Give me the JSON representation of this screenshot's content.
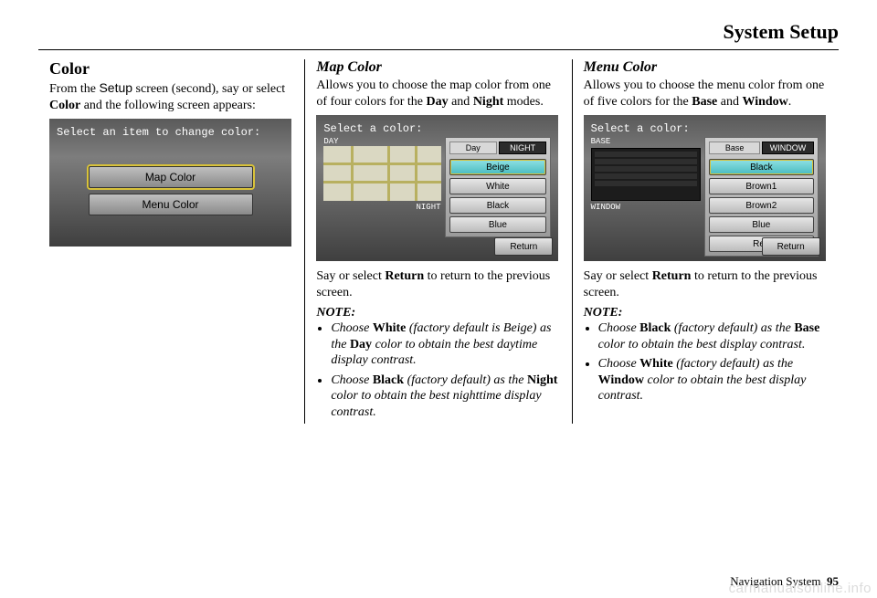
{
  "page": {
    "header": "System Setup",
    "footer_label": "Navigation System",
    "page_number": "95",
    "watermark": "carmanualsonline.info"
  },
  "col1": {
    "heading": "Color",
    "p1_a": "From the ",
    "p1_setup": "Setup",
    "p1_b": " screen (second), say or select ",
    "p1_color": "Color",
    "p1_c": " and the following screen appears:",
    "ss": {
      "title": "Select an item to change color:",
      "btn1": "Map Color",
      "btn2": "Menu Color"
    }
  },
  "col2": {
    "heading": "Map Color",
    "p1_a": "Allows you to choose the map color from one of four colors for the ",
    "p1_day": "Day",
    "p1_mid": " and ",
    "p1_night": "Night",
    "p1_b": " modes.",
    "ss": {
      "title": "Select a color:",
      "day_label": "DAY",
      "night_label": "NIGHT",
      "tab_day": "Day",
      "tab_night": "NIGHT",
      "opt1": "Beige",
      "opt2": "White",
      "opt3": "Black",
      "opt4": "Blue",
      "return": "Return"
    },
    "p2_a": "Say or select ",
    "p2_return": "Return",
    "p2_b": " to return to the previous screen.",
    "note_label": "NOTE:",
    "note1_a": "Choose ",
    "note1_white": "White",
    "note1_b": " (factory default is Beige) as the ",
    "note1_day": "Day",
    "note1_c": " color to obtain the best daytime display contrast.",
    "note2_a": "Choose ",
    "note2_black": "Black",
    "note2_b": " (factory default) as the ",
    "note2_night": "Night",
    "note2_c": " color to obtain the best nighttime display contrast."
  },
  "col3": {
    "heading": "Menu Color",
    "p1_a": "Allows you to choose the menu color from one of five colors for the ",
    "p1_base": "Base",
    "p1_mid": " and ",
    "p1_window": "Window",
    "p1_b": ".",
    "ss": {
      "title": "Select a color:",
      "base_label": "BASE",
      "window_label": "WINDOW",
      "tab_base": "Base",
      "tab_window": "WINDOW",
      "opt1": "Black",
      "opt2": "Brown1",
      "opt3": "Brown2",
      "opt4": "Blue",
      "opt5": "Red",
      "return": "Return"
    },
    "p2_a": "Say or select ",
    "p2_return": "Return",
    "p2_b": " to return to the previous screen.",
    "note_label": "NOTE:",
    "note1_a": "Choose ",
    "note1_black": "Black",
    "note1_b": " (factory default) as the ",
    "note1_base": "Base",
    "note1_c": " color to obtain the best display contrast.",
    "note2_a": "Choose ",
    "note2_white": "White",
    "note2_b": " (factory default) as the ",
    "note2_window": "Window",
    "note2_c": " color to obtain the best display contrast."
  }
}
